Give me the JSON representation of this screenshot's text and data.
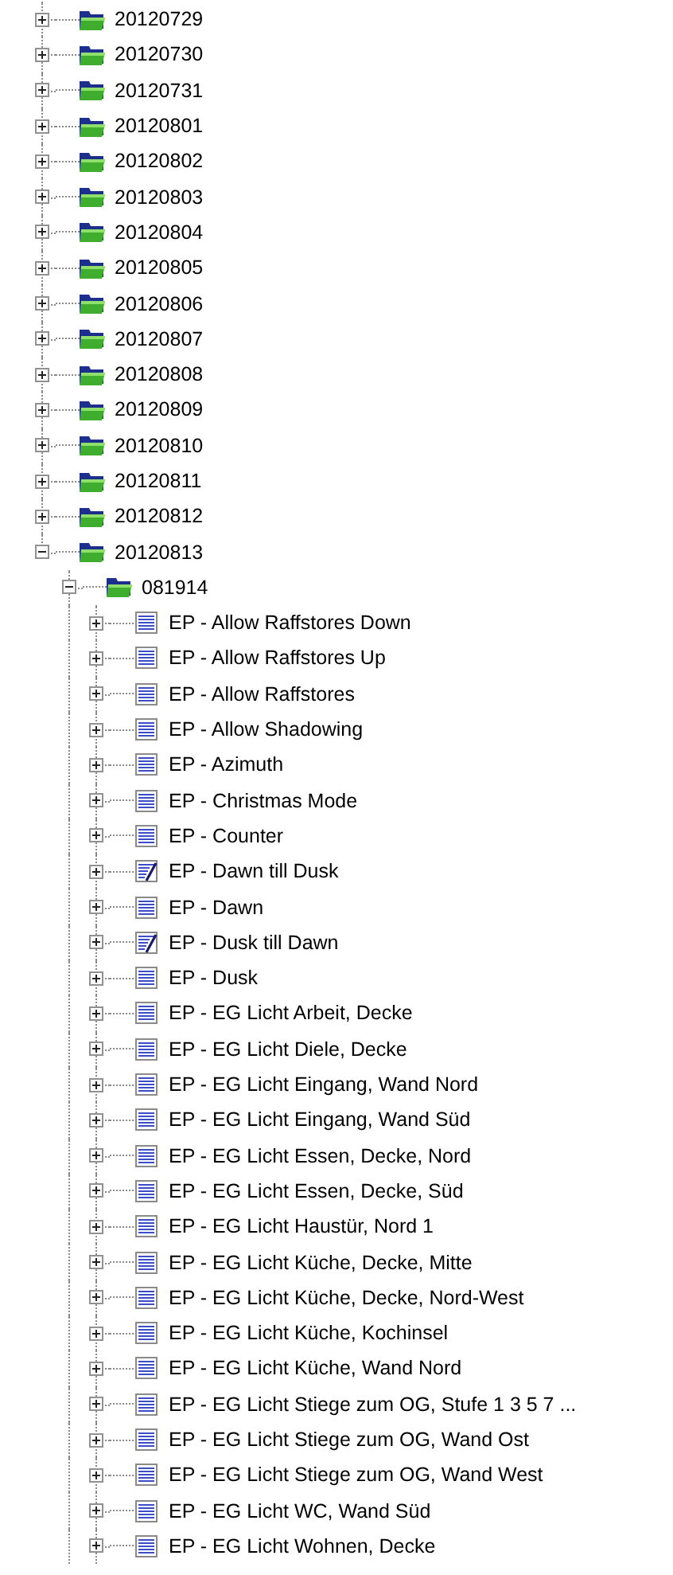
{
  "tree": [
    {
      "label": "20120729",
      "kind": "folder",
      "expanded": false
    },
    {
      "label": "20120730",
      "kind": "folder",
      "expanded": false
    },
    {
      "label": "20120731",
      "kind": "folder",
      "expanded": false
    },
    {
      "label": "20120801",
      "kind": "folder",
      "expanded": false
    },
    {
      "label": "20120802",
      "kind": "folder",
      "expanded": false
    },
    {
      "label": "20120803",
      "kind": "folder",
      "expanded": false
    },
    {
      "label": "20120804",
      "kind": "folder",
      "expanded": false
    },
    {
      "label": "20120805",
      "kind": "folder",
      "expanded": false
    },
    {
      "label": "20120806",
      "kind": "folder",
      "expanded": false
    },
    {
      "label": "20120807",
      "kind": "folder",
      "expanded": false
    },
    {
      "label": "20120808",
      "kind": "folder",
      "expanded": false
    },
    {
      "label": "20120809",
      "kind": "folder",
      "expanded": false
    },
    {
      "label": "20120810",
      "kind": "folder",
      "expanded": false
    },
    {
      "label": "20120811",
      "kind": "folder",
      "expanded": false
    },
    {
      "label": "20120812",
      "kind": "folder",
      "expanded": false
    },
    {
      "label": "20120813",
      "kind": "folder",
      "expanded": true,
      "more_children": true,
      "children": [
        {
          "label": "081914",
          "kind": "folder",
          "expanded": true,
          "more_children": true,
          "children": [
            {
              "label": "EP - Allow Raffstores Down",
              "kind": "list",
              "expanded": false
            },
            {
              "label": "EP - Allow Raffstores Up",
              "kind": "list",
              "expanded": false
            },
            {
              "label": "EP - Allow Raffstores",
              "kind": "list",
              "expanded": false
            },
            {
              "label": "EP - Allow Shadowing",
              "kind": "list",
              "expanded": false
            },
            {
              "label": "EP - Azimuth",
              "kind": "list",
              "expanded": false
            },
            {
              "label": "EP - Christmas Mode",
              "kind": "list",
              "expanded": false
            },
            {
              "label": "EP - Counter",
              "kind": "list",
              "expanded": false
            },
            {
              "label": "EP - Dawn till Dusk",
              "kind": "edit",
              "expanded": false
            },
            {
              "label": "EP - Dawn",
              "kind": "list",
              "expanded": false
            },
            {
              "label": "EP - Dusk till Dawn",
              "kind": "edit",
              "expanded": false
            },
            {
              "label": "EP - Dusk",
              "kind": "list",
              "expanded": false
            },
            {
              "label": "EP - EG Licht Arbeit, Decke",
              "kind": "list",
              "expanded": false
            },
            {
              "label": "EP - EG Licht Diele, Decke",
              "kind": "list",
              "expanded": false
            },
            {
              "label": "EP - EG Licht Eingang, Wand Nord",
              "kind": "list",
              "expanded": false
            },
            {
              "label": "EP - EG Licht Eingang, Wand Süd",
              "kind": "list",
              "expanded": false
            },
            {
              "label": "EP - EG Licht Essen, Decke, Nord",
              "kind": "list",
              "expanded": false
            },
            {
              "label": "EP - EG Licht Essen, Decke, Süd",
              "kind": "list",
              "expanded": false
            },
            {
              "label": "EP - EG Licht Haustür, Nord 1",
              "kind": "list",
              "expanded": false
            },
            {
              "label": "EP - EG Licht Küche, Decke, Mitte",
              "kind": "list",
              "expanded": false
            },
            {
              "label": "EP - EG Licht Küche, Decke, Nord-West",
              "kind": "list",
              "expanded": false
            },
            {
              "label": "EP - EG Licht Küche, Kochinsel",
              "kind": "list",
              "expanded": false
            },
            {
              "label": "EP - EG Licht Küche, Wand Nord",
              "kind": "list",
              "expanded": false
            },
            {
              "label": "EP - EG Licht Stiege zum OG, Stufe 1 3 5 7 ...",
              "kind": "list",
              "expanded": false
            },
            {
              "label": "EP - EG Licht Stiege zum OG, Wand Ost",
              "kind": "list",
              "expanded": false
            },
            {
              "label": "EP - EG Licht Stiege zum OG, Wand West",
              "kind": "list",
              "expanded": false
            },
            {
              "label": "EP - EG Licht WC, Wand Süd",
              "kind": "list",
              "expanded": false
            },
            {
              "label": "EP - EG Licht Wohnen, Decke",
              "kind": "list",
              "expanded": false
            }
          ]
        }
      ]
    }
  ]
}
